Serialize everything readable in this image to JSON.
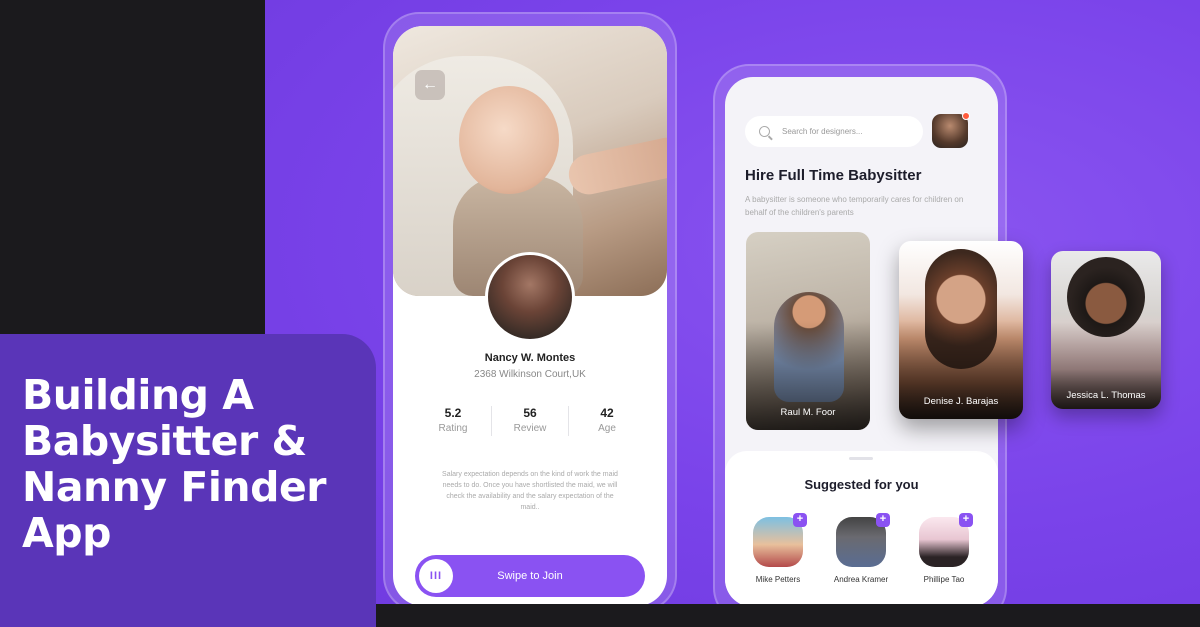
{
  "headline": "Building A Babysitter & Nanny Finder App",
  "profile_screen": {
    "back_icon": "arrow-left-icon",
    "name": "Nancy W. Montes",
    "address": "2368 Wilkinson Court,UK",
    "stats": [
      {
        "value": "5.2",
        "label": "Rating"
      },
      {
        "value": "56",
        "label": "Review"
      },
      {
        "value": "42",
        "label": "Age"
      }
    ],
    "description": "Salary expectation depends on the kind of work the maid needs to do. Once you have shortlisted the maid, we will check the availability and the salary expectation of the maid..",
    "swipe_knob": "III",
    "swipe_label": "Swipe to Join"
  },
  "home_screen": {
    "search_placeholder": "Search for designers...",
    "title": "Hire Full Time Babysitter",
    "subtitle": "A babysitter is someone who temporarily cares for children on behalf of the children's parents",
    "sitters": [
      {
        "name": "Raul M. Foor"
      },
      {
        "name": "Denise J. Barajas"
      },
      {
        "name": "Jessica L. Thomas"
      }
    ],
    "suggested_title": "Suggested for you",
    "suggested": [
      {
        "name": "Mike Petters"
      },
      {
        "name": "Andrea Kramer"
      },
      {
        "name": "Phillipe Tao"
      }
    ],
    "plus_symbol": "+"
  },
  "colors": {
    "accent": "#8a52f2",
    "title_card": "#5a35b8",
    "background_dark": "#1b1a1d"
  }
}
